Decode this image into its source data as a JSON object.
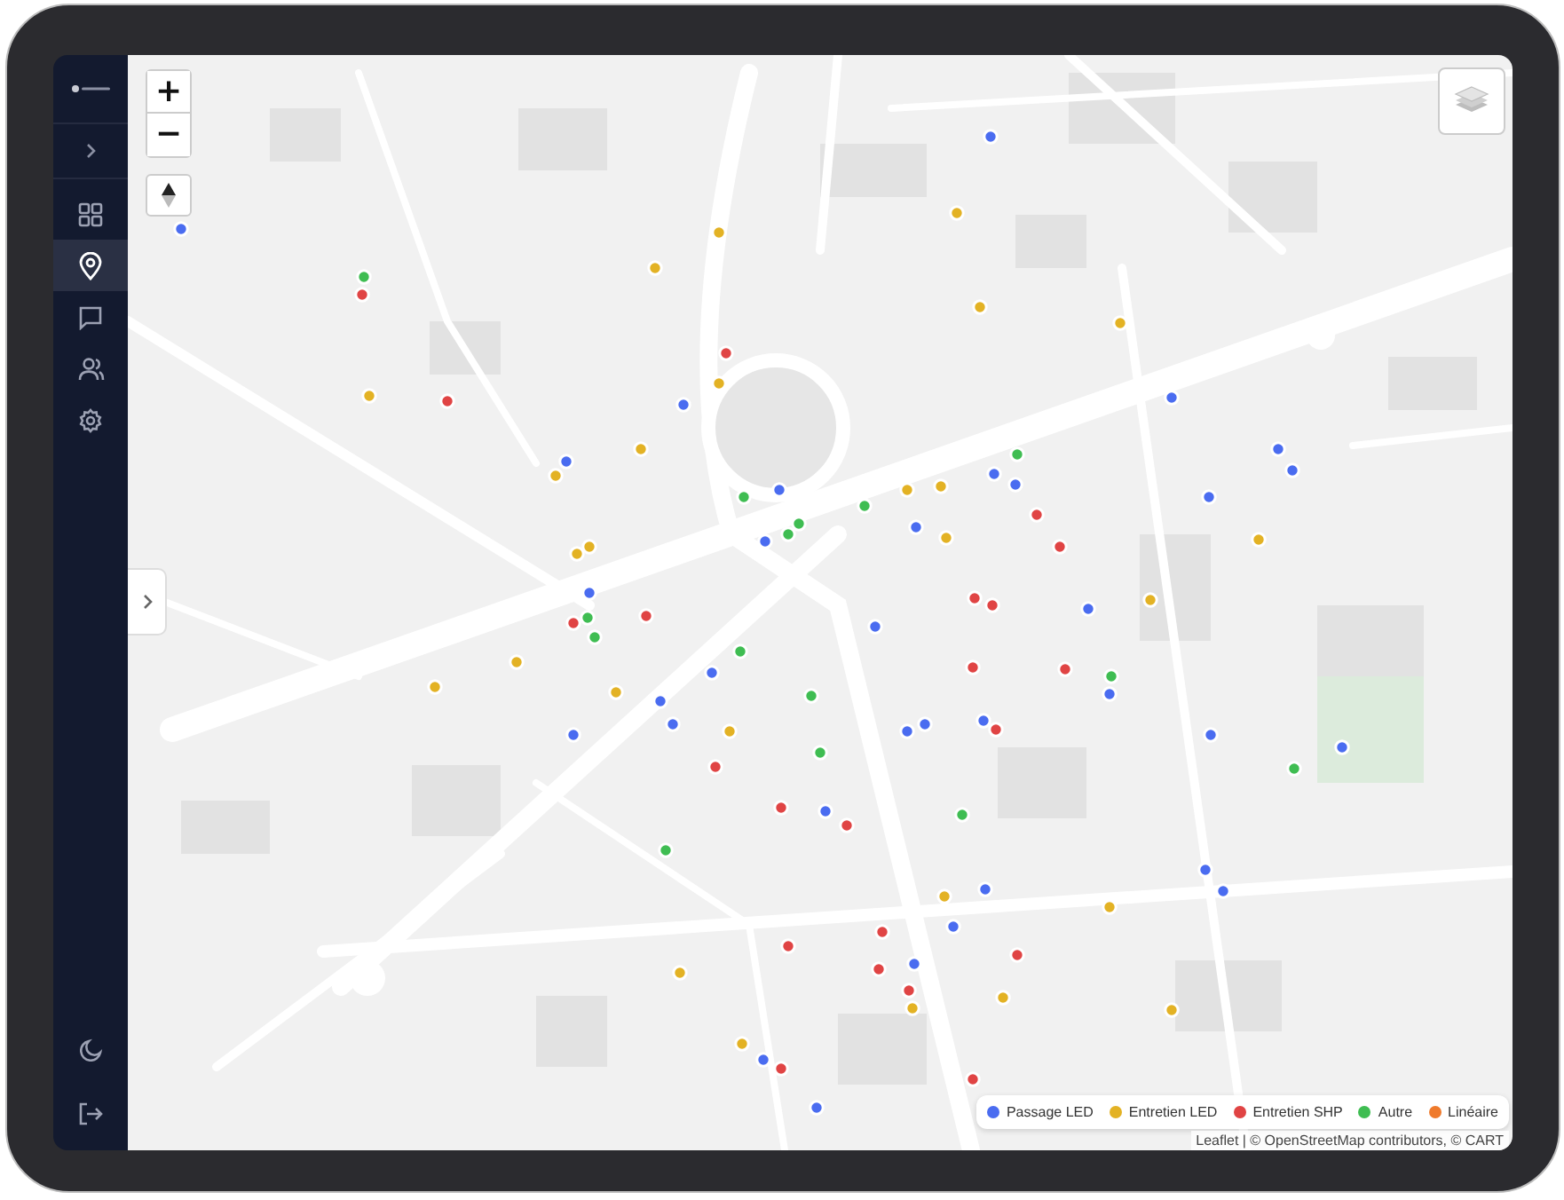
{
  "sidebar": {
    "nav_items": [
      {
        "kind": "grid",
        "selected": false
      },
      {
        "kind": "pin",
        "selected": true
      },
      {
        "kind": "message",
        "selected": false
      },
      {
        "kind": "users",
        "selected": false
      },
      {
        "kind": "settings",
        "selected": false
      }
    ]
  },
  "map": {
    "zoom_in": "+",
    "zoom_out": "−",
    "legend": [
      {
        "label": "Passage LED",
        "color": "#4a6cf0"
      },
      {
        "label": "Entretien LED",
        "color": "#e3b224"
      },
      {
        "label": "Entretien SHP",
        "color": "#e04444"
      },
      {
        "label": "Autre",
        "color": "#3fbd52"
      },
      {
        "label": "Linéaire",
        "color": "#ef7a2c"
      }
    ],
    "attribution": "Leaflet | © OpenStreetMap contributors, © CART"
  }
}
